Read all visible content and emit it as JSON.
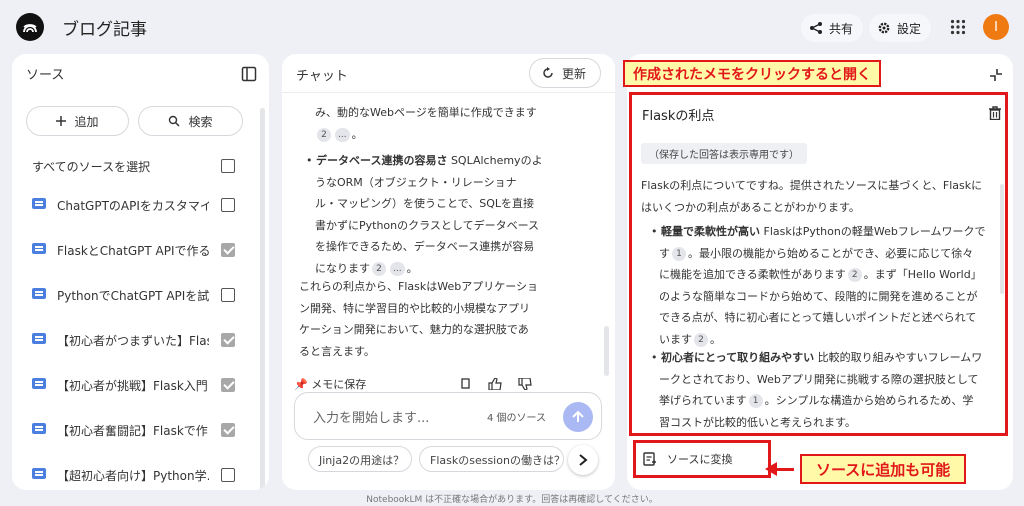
{
  "app": {
    "title": "ブログ記事",
    "avatar_letter": "I"
  },
  "header": {
    "share_label": "共有",
    "settings_label": "設定"
  },
  "sources": {
    "title": "ソース",
    "add_label": "追加",
    "search_label": "検索",
    "select_all_label": "すべてのソースを選択",
    "items": [
      {
        "label": "ChatGPTのAPIをカスタマイ...",
        "checked": false
      },
      {
        "label": "FlaskとChatGPT APIで作る...",
        "checked": true
      },
      {
        "label": "PythonでChatGPT APIを試...",
        "checked": false
      },
      {
        "label": "【初心者がつまずいた】Flas...",
        "checked": true
      },
      {
        "label": "【初心者が挑戦】Flask入門...",
        "checked": true
      },
      {
        "label": "【初心者奮闘記】Flaskで作...",
        "checked": true
      },
      {
        "label": "【超初心者向け】Python学...",
        "checked": false
      }
    ]
  },
  "chat": {
    "title": "チャット",
    "refresh_label": "更新",
    "line_1": "み、動的なWebページを簡単に作成できます",
    "cite_2": "2",
    "cite_more": "...",
    "line_2_end": "。",
    "bullet_bold": "データベース連携の容易さ",
    "bullet_text_1": " SQLAlchemyのよ",
    "bullet_lines": [
      "うなORM（オブジェクト・リレーショナ",
      "ル・マッピング）を使うことで、SQLを直接",
      "書かずにPythonのクラスとしてデータベース",
      "を操作できるため、データベース連携が容易"
    ],
    "bullet_last": "になります",
    "summary_lines": [
      "これらの利点から、FlaskはWebアプリケーショ",
      "ン開発、特に学習目的や比較的小規模なアプリ",
      "ケーション開発において、魅力的な選択肢であ",
      "ると言えます。"
    ],
    "save_note_label": "メモに保存",
    "input_placeholder": "入力を開始します...",
    "source_count": "4 個のソース",
    "suggestions": [
      "Jinja2の用途は？",
      "Flaskのsessionの働きは？"
    ]
  },
  "note": {
    "title": "Flaskの利点",
    "readonly_badge": "（保存した回答は表示専用です）",
    "intro_lines": [
      "Flaskの利点についてですね。提供されたソースに基づくと、Flaskに",
      "はいくつかの利点があることがわかります。"
    ],
    "b1_bold": "軽量で柔軟性が高い",
    "b1_line1": " FlaskはPythonの軽量Webフレームワークで",
    "b1_line2a": "す",
    "b1_cite": "1",
    "b1_line2b": "。最小限の機能から始めることができ、必要に応じて徐々",
    "b1_line3a": "に機能を追加できる柔軟性があります",
    "b1_cite2": "2",
    "b1_line3b": "。まず「Hello World」",
    "b1_lines": [
      "のような簡単なコードから始めて、段階的に開発を進めることが",
      "できる点が、特に初心者にとって嬉しいポイントだと述べられて"
    ],
    "b1_last": "います",
    "b2_bold": "初心者にとって取り組みやすい",
    "b2_line1": " 比較的取り組みやすいフレームワ",
    "b2_line2": "ークとされており、Webアプリ開発に挑戦する際の選択肢として",
    "b2_line3a": "挙げられています",
    "b2_cite": "1",
    "b2_line3b": "。シンプルな構造から始められるため、学",
    "b2_line4": "習コストが比較的低いと考えられます。",
    "convert_label": "ソースに変換"
  },
  "annotations": {
    "top_callout": "作成されたメモをクリックすると開く",
    "bottom_callout": "ソースに追加も可能"
  },
  "footer": {
    "text": "NotebookLM は不正確な場合があります。回答は再確認してください。"
  },
  "colors": {
    "accent_red": "#e2171a",
    "callout_bg": "#fff9a8",
    "avatar": "#f07a12",
    "doc_icon": "#4a7fe0",
    "send": "#aab8f3"
  }
}
